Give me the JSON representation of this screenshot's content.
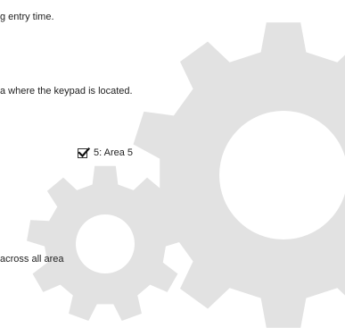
{
  "lines": {
    "entry_time": "g entry time.",
    "keypad_area": "a where the keypad is located.",
    "across_all": "across all area"
  },
  "area_checkbox": {
    "label": "5: Area 5",
    "checked": true
  },
  "colors": {
    "gear": "#e2e2e2",
    "text": "#222222",
    "background": "#ffffff"
  },
  "icons": {
    "background": "gear-icon",
    "checkbox": "checkmark-icon"
  }
}
